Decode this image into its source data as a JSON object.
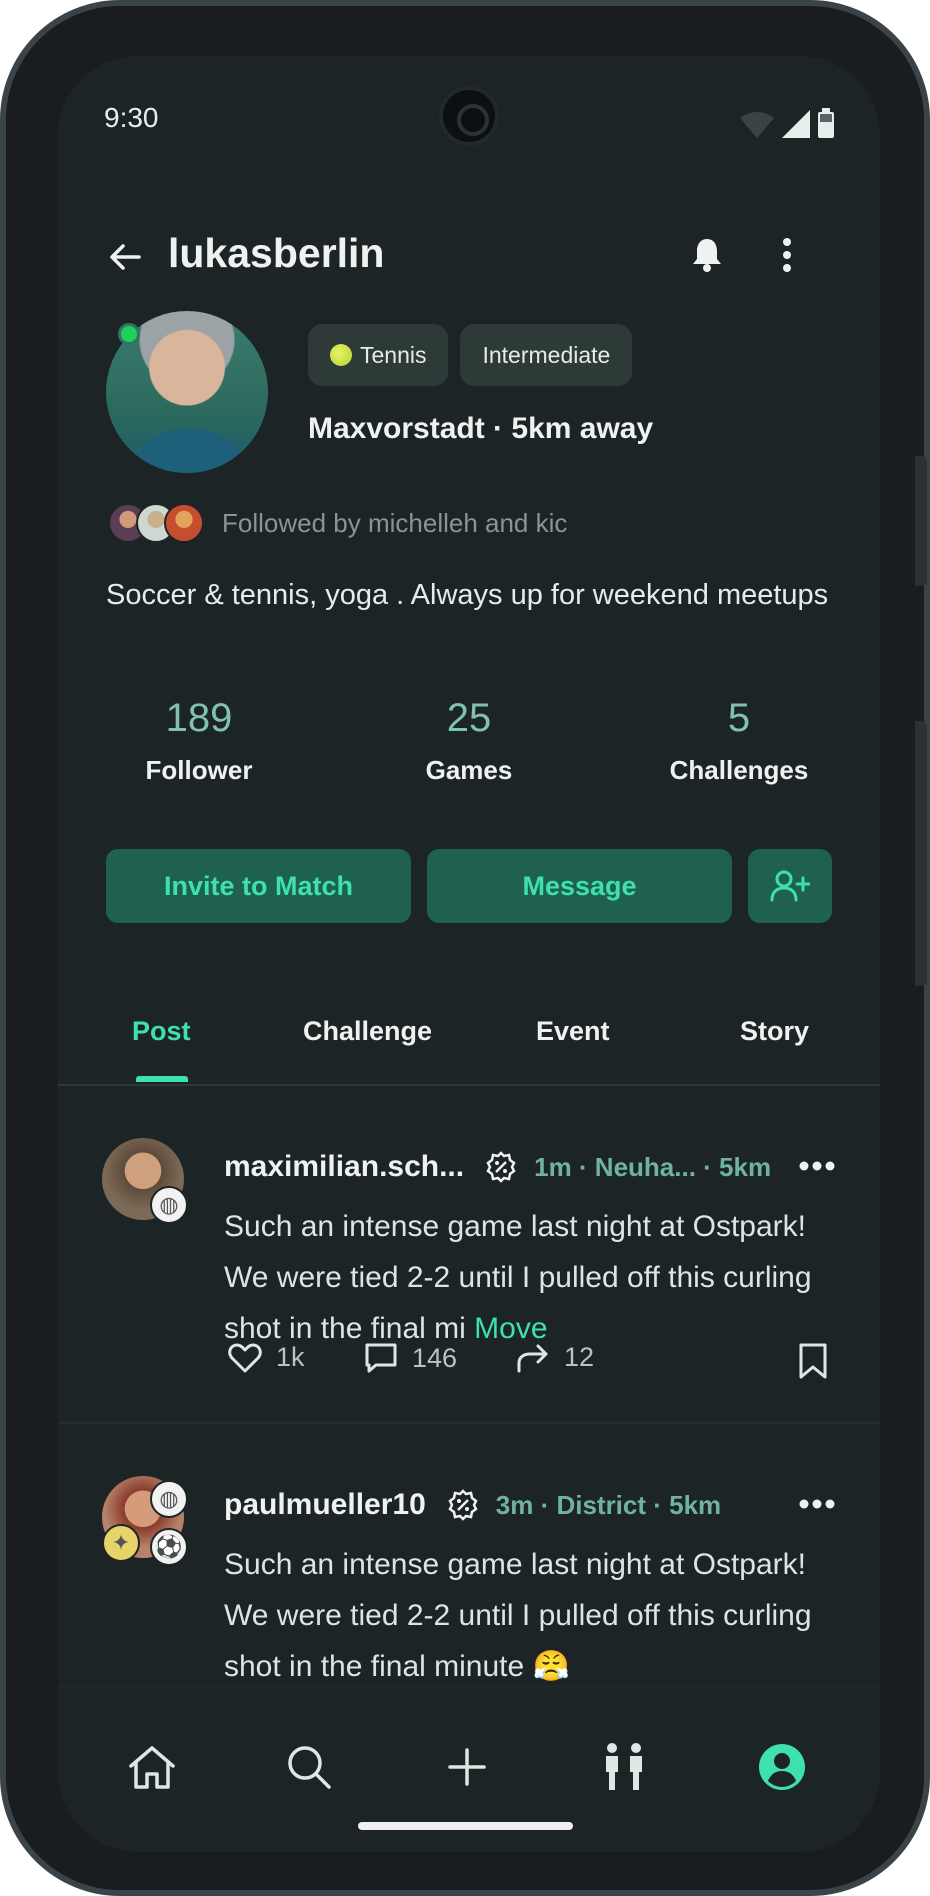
{
  "status_bar": {
    "time": "9:30"
  },
  "header": {
    "username": "lukasberlin"
  },
  "profile": {
    "chips": [
      "Tennis",
      "Intermediate"
    ],
    "location": "Maxvorstadt · 5km away",
    "followed_by": "Followed by michelleh and kic",
    "bio": "Soccer & tennis, yoga . Always up for weekend meetups",
    "online_color": "#22d15c"
  },
  "stats": [
    {
      "value": "189",
      "label": "Follower"
    },
    {
      "value": "25",
      "label": "Games"
    },
    {
      "value": "5",
      "label": "Challenges"
    }
  ],
  "actions": {
    "invite": "Invite to Match",
    "message": "Message",
    "add_friend_icon": "add-user-icon"
  },
  "tabs": [
    "Post",
    "Challenge",
    "Event",
    "Story"
  ],
  "active_tab": "Post",
  "posts": [
    {
      "user": "maximilian.sch...",
      "meta": "1m ·  Neuha... · 5km",
      "text": "Such an intense game last night at Ostpark! We were tied 2-2 until I pulled off this curling shot in the final mi",
      "more": "Move",
      "likes": "1k",
      "comments": "146",
      "shares": "12"
    },
    {
      "user": "paulmueller10",
      "meta": "3m · District · 5km",
      "text": "Such an intense game last night at Ostpark! We were tied 2-2 until I pulled off this curling shot in the final minute 😤"
    }
  ],
  "colors": {
    "accent": "#3fe0b0",
    "button_bg": "#1e6150",
    "stat_number": "#7fc2b4",
    "background": "#1d2426"
  },
  "nav": [
    "home-icon",
    "search-icon",
    "plus-icon",
    "people-icon",
    "profile-icon"
  ]
}
